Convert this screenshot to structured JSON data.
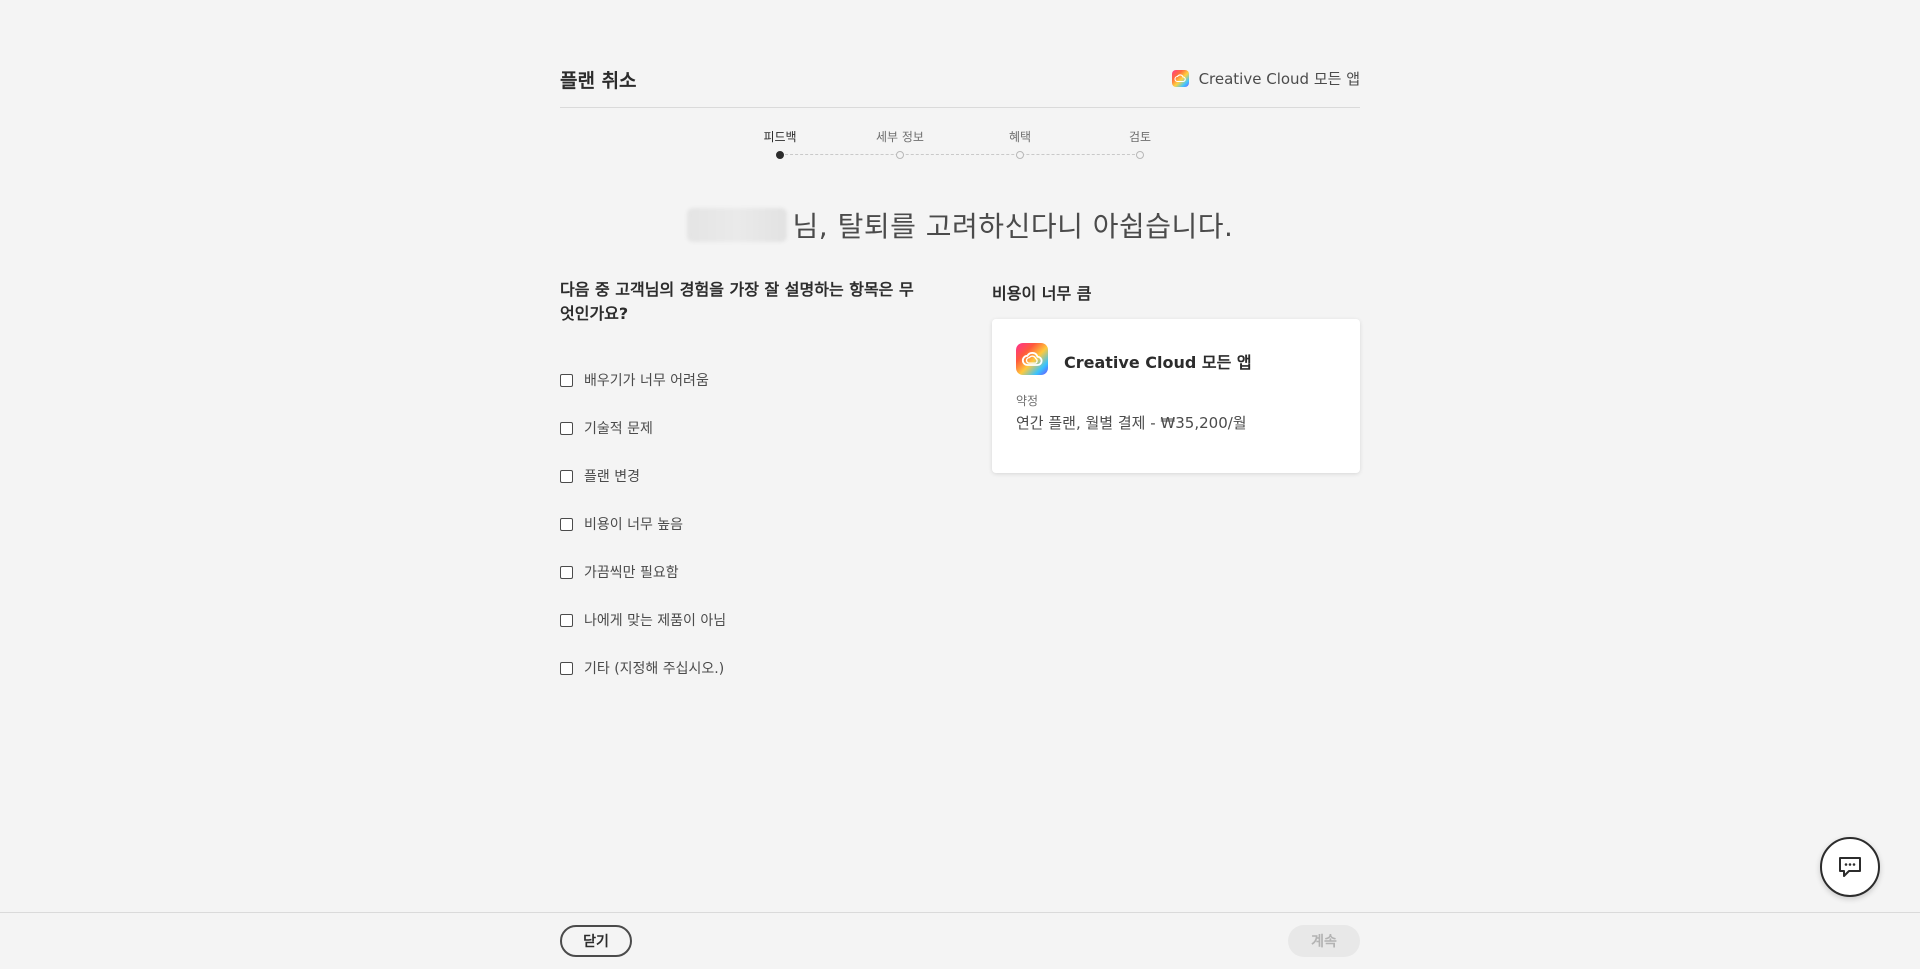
{
  "header": {
    "title": "플랜 취소",
    "product_name": "Creative Cloud 모든 앱"
  },
  "stepper": {
    "steps": [
      {
        "label": "피드백",
        "active": true
      },
      {
        "label": "세부 정보",
        "active": false
      },
      {
        "label": "혜택",
        "active": false
      },
      {
        "label": "검토",
        "active": false
      }
    ]
  },
  "headline": {
    "text": "님, 탈퇴를 고려하신다니 아쉽습니다."
  },
  "survey": {
    "question": "다음 중 고객님의 경험을 가장 잘 설명하는 항목은 무엇인가요?",
    "options": [
      "배우기가 너무 어려움",
      "기술적 문제",
      "플랜 변경",
      "비용이 너무 높음",
      "가끔씩만 필요함",
      "나에게 맞는 제품이 아님",
      "기타 (지정해 주십시오.)"
    ]
  },
  "reason": {
    "title": "비용이 너무 큼"
  },
  "plan_card": {
    "name": "Creative Cloud 모든 앱",
    "commitment_label": "약정",
    "commitment_value": "연간 플랜, 월별 결제 - ₩35,200/월"
  },
  "footer": {
    "close_label": "닫기",
    "continue_label": "계속"
  },
  "icons": {
    "product": "creative-cloud-icon",
    "chat": "chat-icon"
  },
  "colors": {
    "background": "#f4f4f4",
    "text_primary": "#2c2c2c",
    "disabled_button_bg": "#e8e8e8"
  }
}
